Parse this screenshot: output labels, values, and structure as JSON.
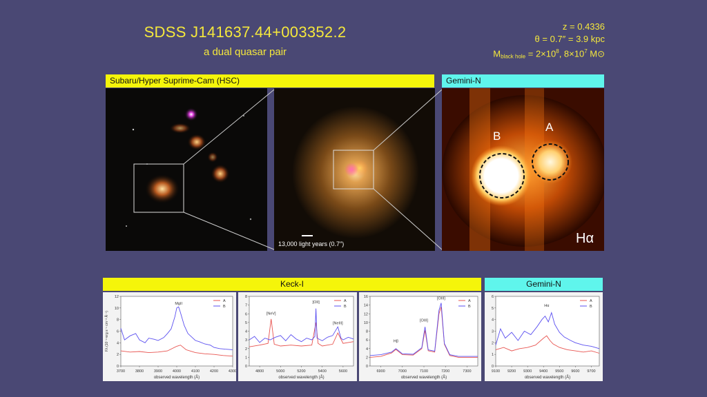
{
  "header": {
    "title": "SDSS J141637.44+003352.2",
    "subtitle": "a dual quasar pair",
    "redshift": "z = 0.4336",
    "separation": "θ = 0.7″ = 3.9 kpc",
    "mass_prefix": "M",
    "mass_sub": "black hole",
    "mass_eq": " = 2×10",
    "mass_exp1": "8",
    "mass_mid": ", 8×10",
    "mass_exp2": "7",
    "mass_unit": " M⊙"
  },
  "imaging": {
    "hsc_label": "Subaru/Hyper Suprime-Cam (HSC)",
    "gemini_label": "Gemini-N",
    "scale_bar_text": "13,000 light years (0.7″)",
    "source_b": "B",
    "source_a": "A",
    "line_label": "Hα"
  },
  "spectra": {
    "keck_label": "Keck-I",
    "gemini_label": "Gemini-N",
    "xlabel": "observed wavelength (Å)",
    "ylabel": "Fλ (10⁻¹⁷erg s⁻¹ cm⁻² Å⁻¹)",
    "legend": [
      "A",
      "B"
    ],
    "colors": {
      "A": "#e8534f",
      "B": "#5a4ff0"
    }
  },
  "chart_data": [
    {
      "type": "line",
      "xlabel": "observed wavelength (Å)",
      "ylabel": "Fλ (10⁻¹⁷erg s⁻¹ cm⁻² Å⁻¹)",
      "xlim": [
        3700,
        4300
      ],
      "ylim": [
        0,
        12
      ],
      "xticks": [
        3700,
        3800,
        3900,
        4000,
        4100,
        4200,
        4300
      ],
      "yticks": [
        0,
        2,
        4,
        6,
        8,
        10,
        12
      ],
      "annotations": [
        {
          "text": "MgII",
          "x": 4010,
          "y": 10.6
        }
      ],
      "series": [
        {
          "name": "A",
          "x": [
            3700,
            3750,
            3800,
            3850,
            3900,
            3950,
            4000,
            4020,
            4050,
            4100,
            4150,
            4200,
            4250,
            4300
          ],
          "values": [
            2.6,
            2.4,
            2.5,
            2.3,
            2.4,
            2.6,
            3.4,
            3.6,
            2.8,
            2.3,
            2.1,
            2.0,
            1.8,
            1.7
          ]
        },
        {
          "name": "B",
          "x": [
            3700,
            3720,
            3750,
            3780,
            3800,
            3830,
            3850,
            3880,
            3900,
            3930,
            3950,
            3970,
            3990,
            4000,
            4010,
            4020,
            4040,
            4060,
            4080,
            4100,
            4120,
            4150,
            4180,
            4200,
            4230,
            4260,
            4300
          ],
          "values": [
            6.5,
            4.5,
            5.2,
            5.6,
            4.5,
            4.0,
            4.8,
            4.6,
            4.4,
            4.9,
            5.6,
            6.4,
            8.5,
            10.0,
            10.2,
            9.2,
            7.0,
            5.6,
            5.0,
            4.4,
            4.2,
            3.8,
            3.6,
            3.2,
            3.0,
            2.9,
            2.8
          ]
        }
      ]
    },
    {
      "type": "line",
      "xlabel": "observed wavelength (Å)",
      "xlim": [
        4700,
        5700
      ],
      "ylim": [
        0,
        8
      ],
      "xticks": [
        4800,
        5000,
        5200,
        5400,
        5600
      ],
      "yticks": [
        0,
        1,
        2,
        3,
        4,
        5,
        6,
        7,
        8
      ],
      "annotations": [
        {
          "text": "[NeV]",
          "x": 4910,
          "y": 5.9
        },
        {
          "text": "[OII]",
          "x": 5340,
          "y": 7.2
        },
        {
          "text": "[NeIII]",
          "x": 5550,
          "y": 4.8
        }
      ],
      "series": [
        {
          "name": "A",
          "x": [
            4700,
            4800,
            4880,
            4910,
            4940,
            5000,
            5100,
            5200,
            5300,
            5340,
            5360,
            5400,
            5500,
            5550,
            5600,
            5700
          ],
          "values": [
            2.2,
            2.4,
            2.6,
            5.4,
            2.5,
            2.3,
            2.4,
            2.3,
            2.4,
            5.0,
            2.6,
            2.3,
            2.5,
            3.8,
            2.6,
            2.8
          ]
        },
        {
          "name": "B",
          "x": [
            4700,
            4750,
            4800,
            4850,
            4900,
            4950,
            5000,
            5050,
            5100,
            5150,
            5200,
            5250,
            5300,
            5330,
            5340,
            5350,
            5400,
            5450,
            5500,
            5550,
            5580,
            5600,
            5650,
            5700
          ],
          "values": [
            3.0,
            3.4,
            2.7,
            3.2,
            3.0,
            3.3,
            3.5,
            2.9,
            3.6,
            3.1,
            2.8,
            3.2,
            3.0,
            3.4,
            6.6,
            3.2,
            2.9,
            3.3,
            3.5,
            4.5,
            3.2,
            3.0,
            3.3,
            3.1
          ]
        }
      ]
    },
    {
      "type": "line",
      "xlabel": "observed wavelength (Å)",
      "xlim": [
        6850,
        7350
      ],
      "ylim": [
        0,
        16
      ],
      "xticks": [
        6900,
        7000,
        7100,
        7200,
        7300
      ],
      "yticks": [
        0,
        2,
        4,
        6,
        8,
        10,
        12,
        14,
        16
      ],
      "annotations": [
        {
          "text": "Hβ",
          "x": 6970,
          "y": 5.5
        },
        {
          "text": "[OIII]",
          "x": 7100,
          "y": 10.2
        },
        {
          "text": "[OIII]",
          "x": 7180,
          "y": 15.3
        }
      ],
      "series": [
        {
          "name": "A",
          "x": [
            6850,
            6900,
            6950,
            6970,
            7000,
            7050,
            7090,
            7105,
            7120,
            7150,
            7170,
            7180,
            7195,
            7220,
            7260,
            7300,
            7350
          ],
          "values": [
            2.0,
            2.2,
            3.0,
            3.8,
            2.6,
            2.5,
            4.0,
            8.2,
            3.5,
            3.2,
            12.0,
            13.6,
            5.0,
            2.4,
            2.0,
            2.0,
            2.0
          ]
        },
        {
          "name": "B",
          "x": [
            6850,
            6900,
            6950,
            6970,
            7000,
            7050,
            7090,
            7105,
            7120,
            7150,
            7170,
            7180,
            7195,
            7220,
            7260,
            7300,
            7350
          ],
          "values": [
            2.4,
            2.6,
            3.2,
            4.0,
            2.8,
            2.7,
            4.2,
            9.0,
            3.7,
            3.4,
            12.8,
            14.5,
            5.2,
            2.6,
            2.2,
            2.2,
            2.2
          ]
        }
      ]
    },
    {
      "type": "line",
      "xlabel": "observed wavelength (Å)",
      "xlim": [
        9100,
        9750
      ],
      "ylim": [
        0,
        6
      ],
      "xticks": [
        9100,
        9200,
        9300,
        9400,
        9500,
        9600,
        9700
      ],
      "yticks": [
        0,
        1,
        2,
        3,
        4,
        5,
        6
      ],
      "annotations": [
        {
          "text": "Hα",
          "x": 9420,
          "y": 5.1
        }
      ],
      "series": [
        {
          "name": "A",
          "x": [
            9100,
            9150,
            9200,
            9250,
            9300,
            9350,
            9400,
            9420,
            9440,
            9460,
            9500,
            9550,
            9600,
            9650,
            9700,
            9750
          ],
          "values": [
            1.4,
            1.6,
            1.3,
            1.5,
            1.6,
            1.8,
            2.4,
            2.6,
            2.2,
            1.9,
            1.6,
            1.4,
            1.3,
            1.2,
            1.3,
            1.1
          ]
        },
        {
          "name": "B",
          "x": [
            9100,
            9130,
            9160,
            9200,
            9240,
            9280,
            9320,
            9360,
            9390,
            9410,
            9430,
            9450,
            9470,
            9500,
            9530,
            9570,
            9600,
            9650,
            9700,
            9750
          ],
          "values": [
            1.8,
            3.2,
            2.4,
            2.9,
            2.2,
            3.0,
            2.7,
            3.4,
            4.0,
            4.3,
            3.8,
            4.6,
            3.6,
            2.9,
            2.5,
            2.2,
            2.0,
            1.8,
            1.7,
            1.5
          ]
        }
      ]
    }
  ]
}
